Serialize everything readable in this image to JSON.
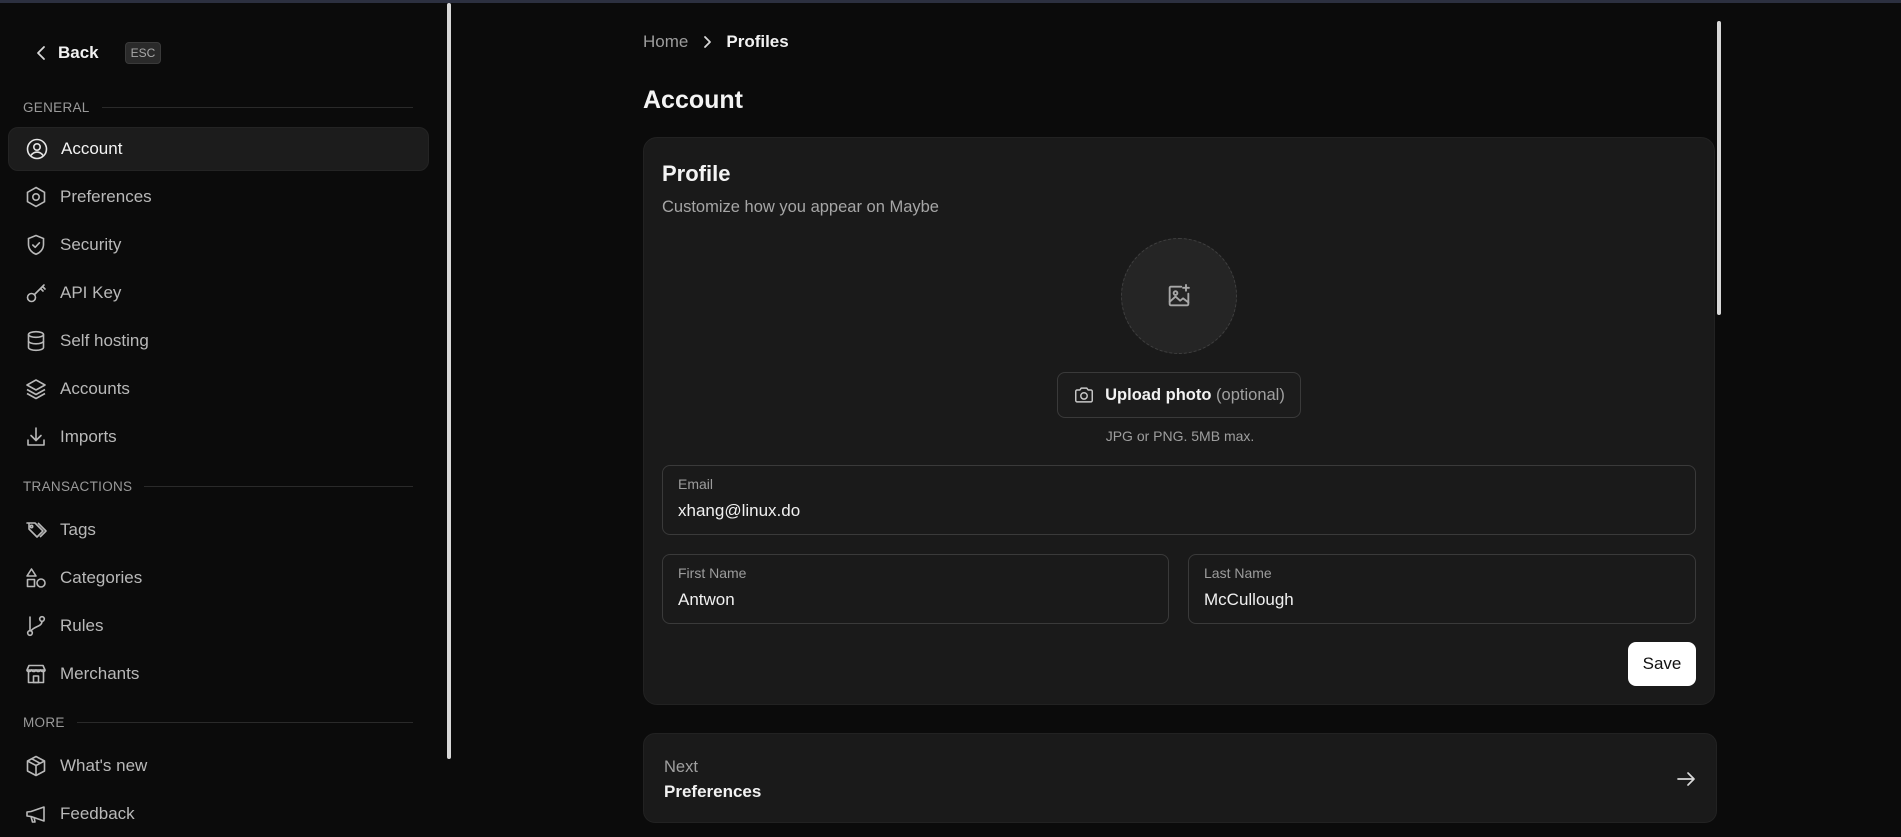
{
  "sidebar": {
    "back_label": "Back",
    "esc_label": "ESC",
    "sections": [
      {
        "label": "GENERAL",
        "items": [
          {
            "label": "Account",
            "icon": "user-circle-icon",
            "active": true
          },
          {
            "label": "Preferences",
            "icon": "settings-hex-icon"
          },
          {
            "label": "Security",
            "icon": "shield-check-icon"
          },
          {
            "label": "API Key",
            "icon": "key-icon"
          },
          {
            "label": "Self hosting",
            "icon": "database-icon"
          },
          {
            "label": "Accounts",
            "icon": "layers-icon"
          },
          {
            "label": "Imports",
            "icon": "download-icon"
          }
        ]
      },
      {
        "label": "TRANSACTIONS",
        "items": [
          {
            "label": "Tags",
            "icon": "tags-icon"
          },
          {
            "label": "Categories",
            "icon": "shapes-icon"
          },
          {
            "label": "Rules",
            "icon": "git-branch-icon"
          },
          {
            "label": "Merchants",
            "icon": "store-icon"
          }
        ]
      },
      {
        "label": "MORE",
        "items": [
          {
            "label": "What's new",
            "icon": "box-icon"
          },
          {
            "label": "Feedback",
            "icon": "megaphone-icon"
          }
        ]
      }
    ]
  },
  "breadcrumb": {
    "home": "Home",
    "current": "Profiles"
  },
  "page_title": "Account",
  "profile": {
    "title": "Profile",
    "subtitle": "Customize how you appear on Maybe",
    "upload_label": "Upload photo",
    "upload_optional": "(optional)",
    "upload_hint": "JPG or PNG. 5MB max.",
    "email": {
      "label": "Email",
      "value": "xhang@linux.do"
    },
    "first_name": {
      "label": "First Name",
      "value": "Antwon"
    },
    "last_name": {
      "label": "Last Name",
      "value": "McCullough"
    },
    "save_label": "Save"
  },
  "next": {
    "label": "Next",
    "target": "Preferences"
  }
}
